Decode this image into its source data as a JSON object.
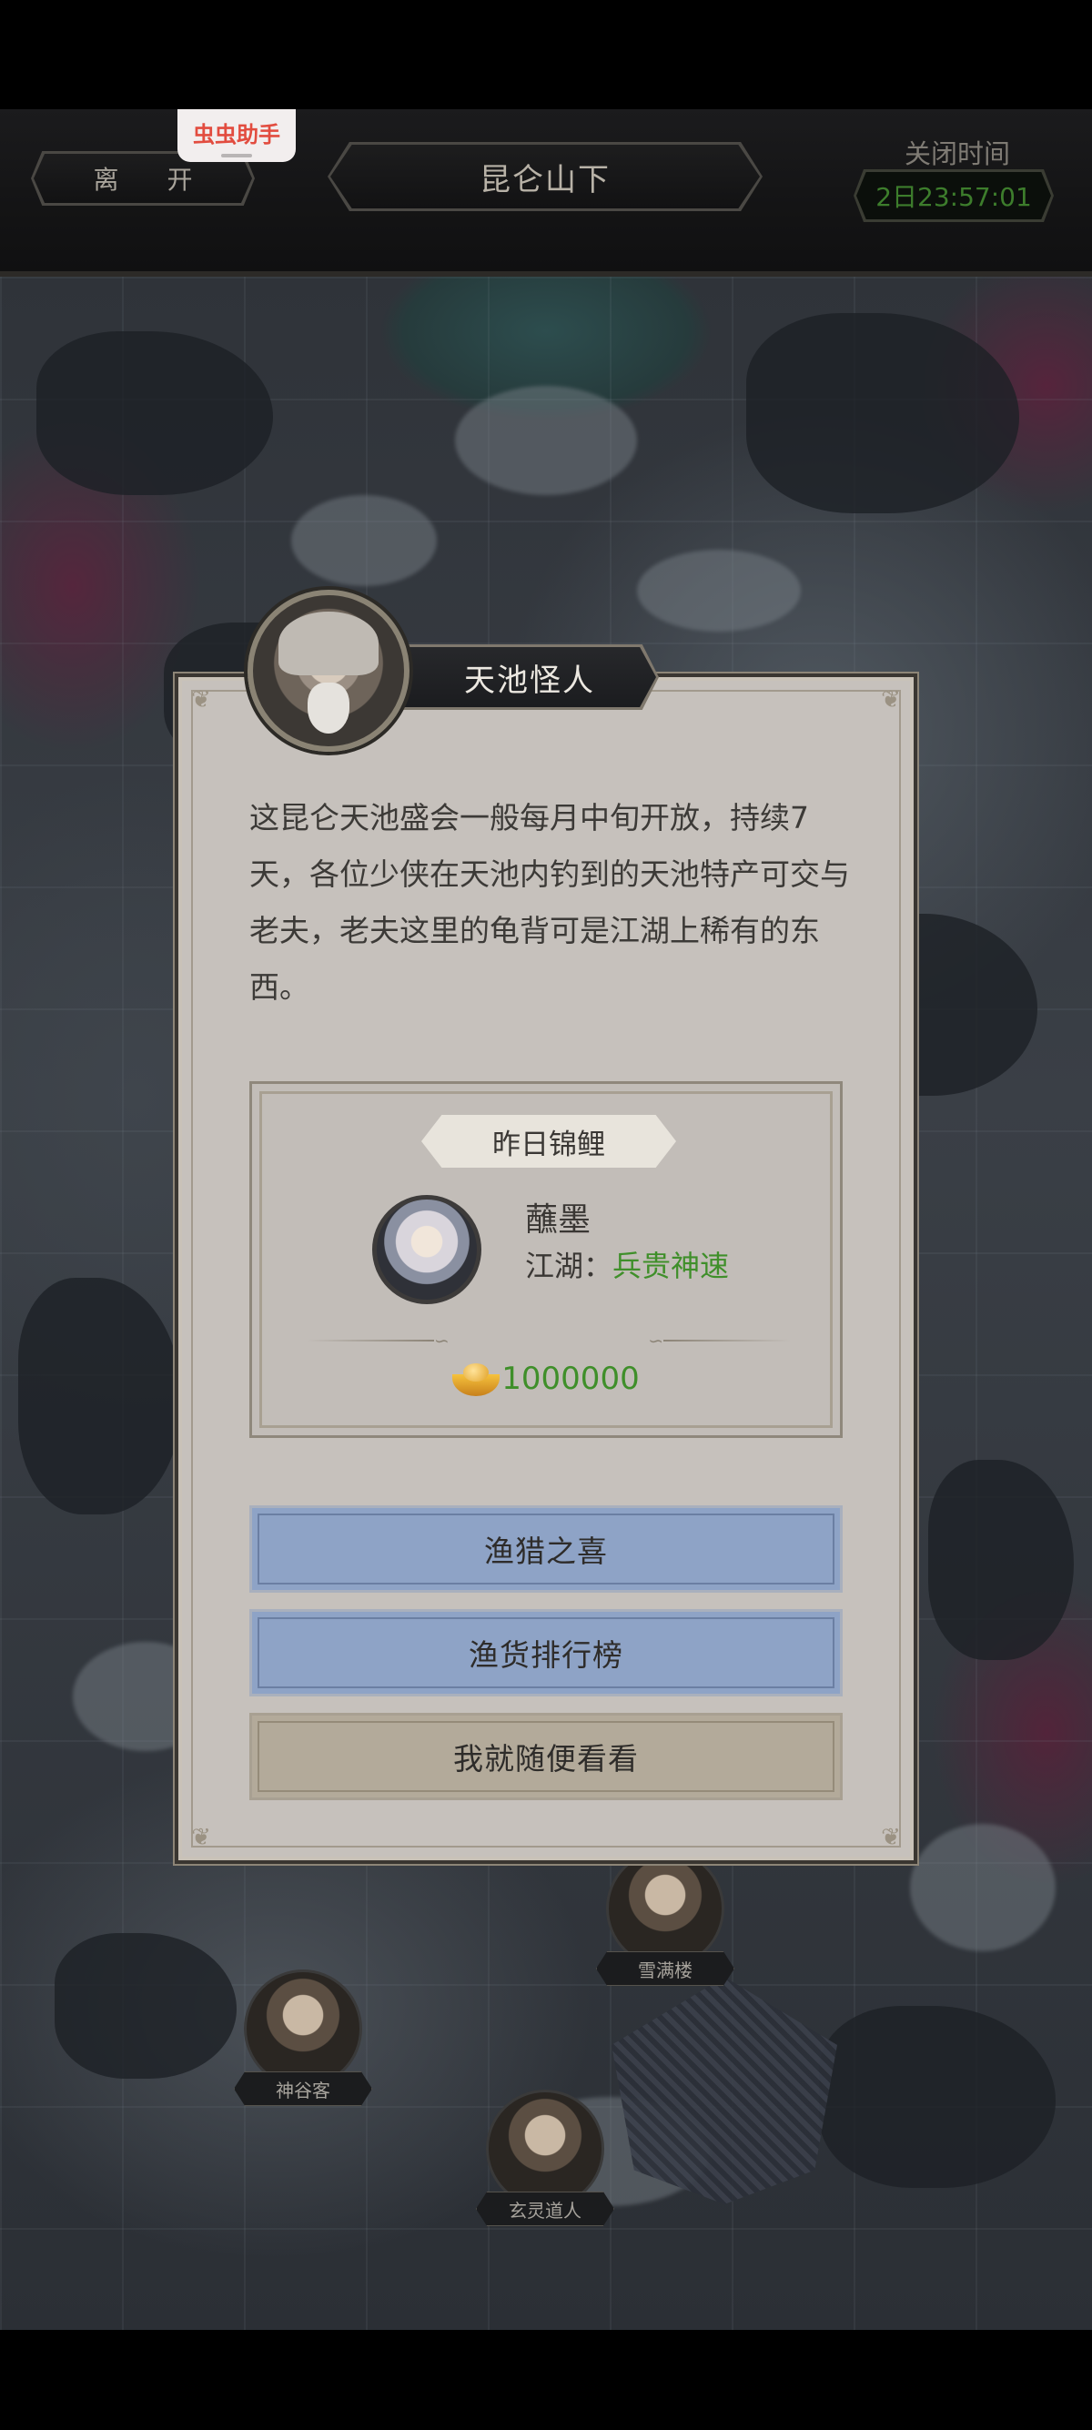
{
  "header": {
    "leave_label": "离 开",
    "location": "昆仑山下",
    "close_time_label": "关闭时间",
    "close_timer": "2日23:57:01"
  },
  "overlay": {
    "helper_label": "虫虫助手"
  },
  "map": {
    "npcs": [
      {
        "name": "雪满楼"
      },
      {
        "name": "神谷客"
      },
      {
        "name": "玄灵道人"
      }
    ]
  },
  "dialog": {
    "npc_name": "天池怪人",
    "text": "这昆仑天池盛会一般每月中旬开放，持续7天，各位少侠在天池内钓到的天池特产可交与老夫，老夫这里的龟背可是江湖上稀有的东西。",
    "koi": {
      "title": "昨日锦鲤",
      "player_name": "蘸墨",
      "sect_label": "江湖：",
      "sect_value": "兵贵神速",
      "reward_amount": "1000000",
      "reward_icon": "gold-ingot-icon",
      "sect_color": "#3f8f2a"
    },
    "buttons": {
      "fishing_joy": "渔猎之喜",
      "catch_ranking": "渔货排行榜",
      "just_browse": "我就随便看看"
    }
  },
  "colors": {
    "panel_bg": "#c6c1bc",
    "button_blue": "#8ea3c6",
    "button_tan": "#b3aa9a",
    "timer_green": "#3d7d2c",
    "helper_red": "#e24c3f"
  }
}
